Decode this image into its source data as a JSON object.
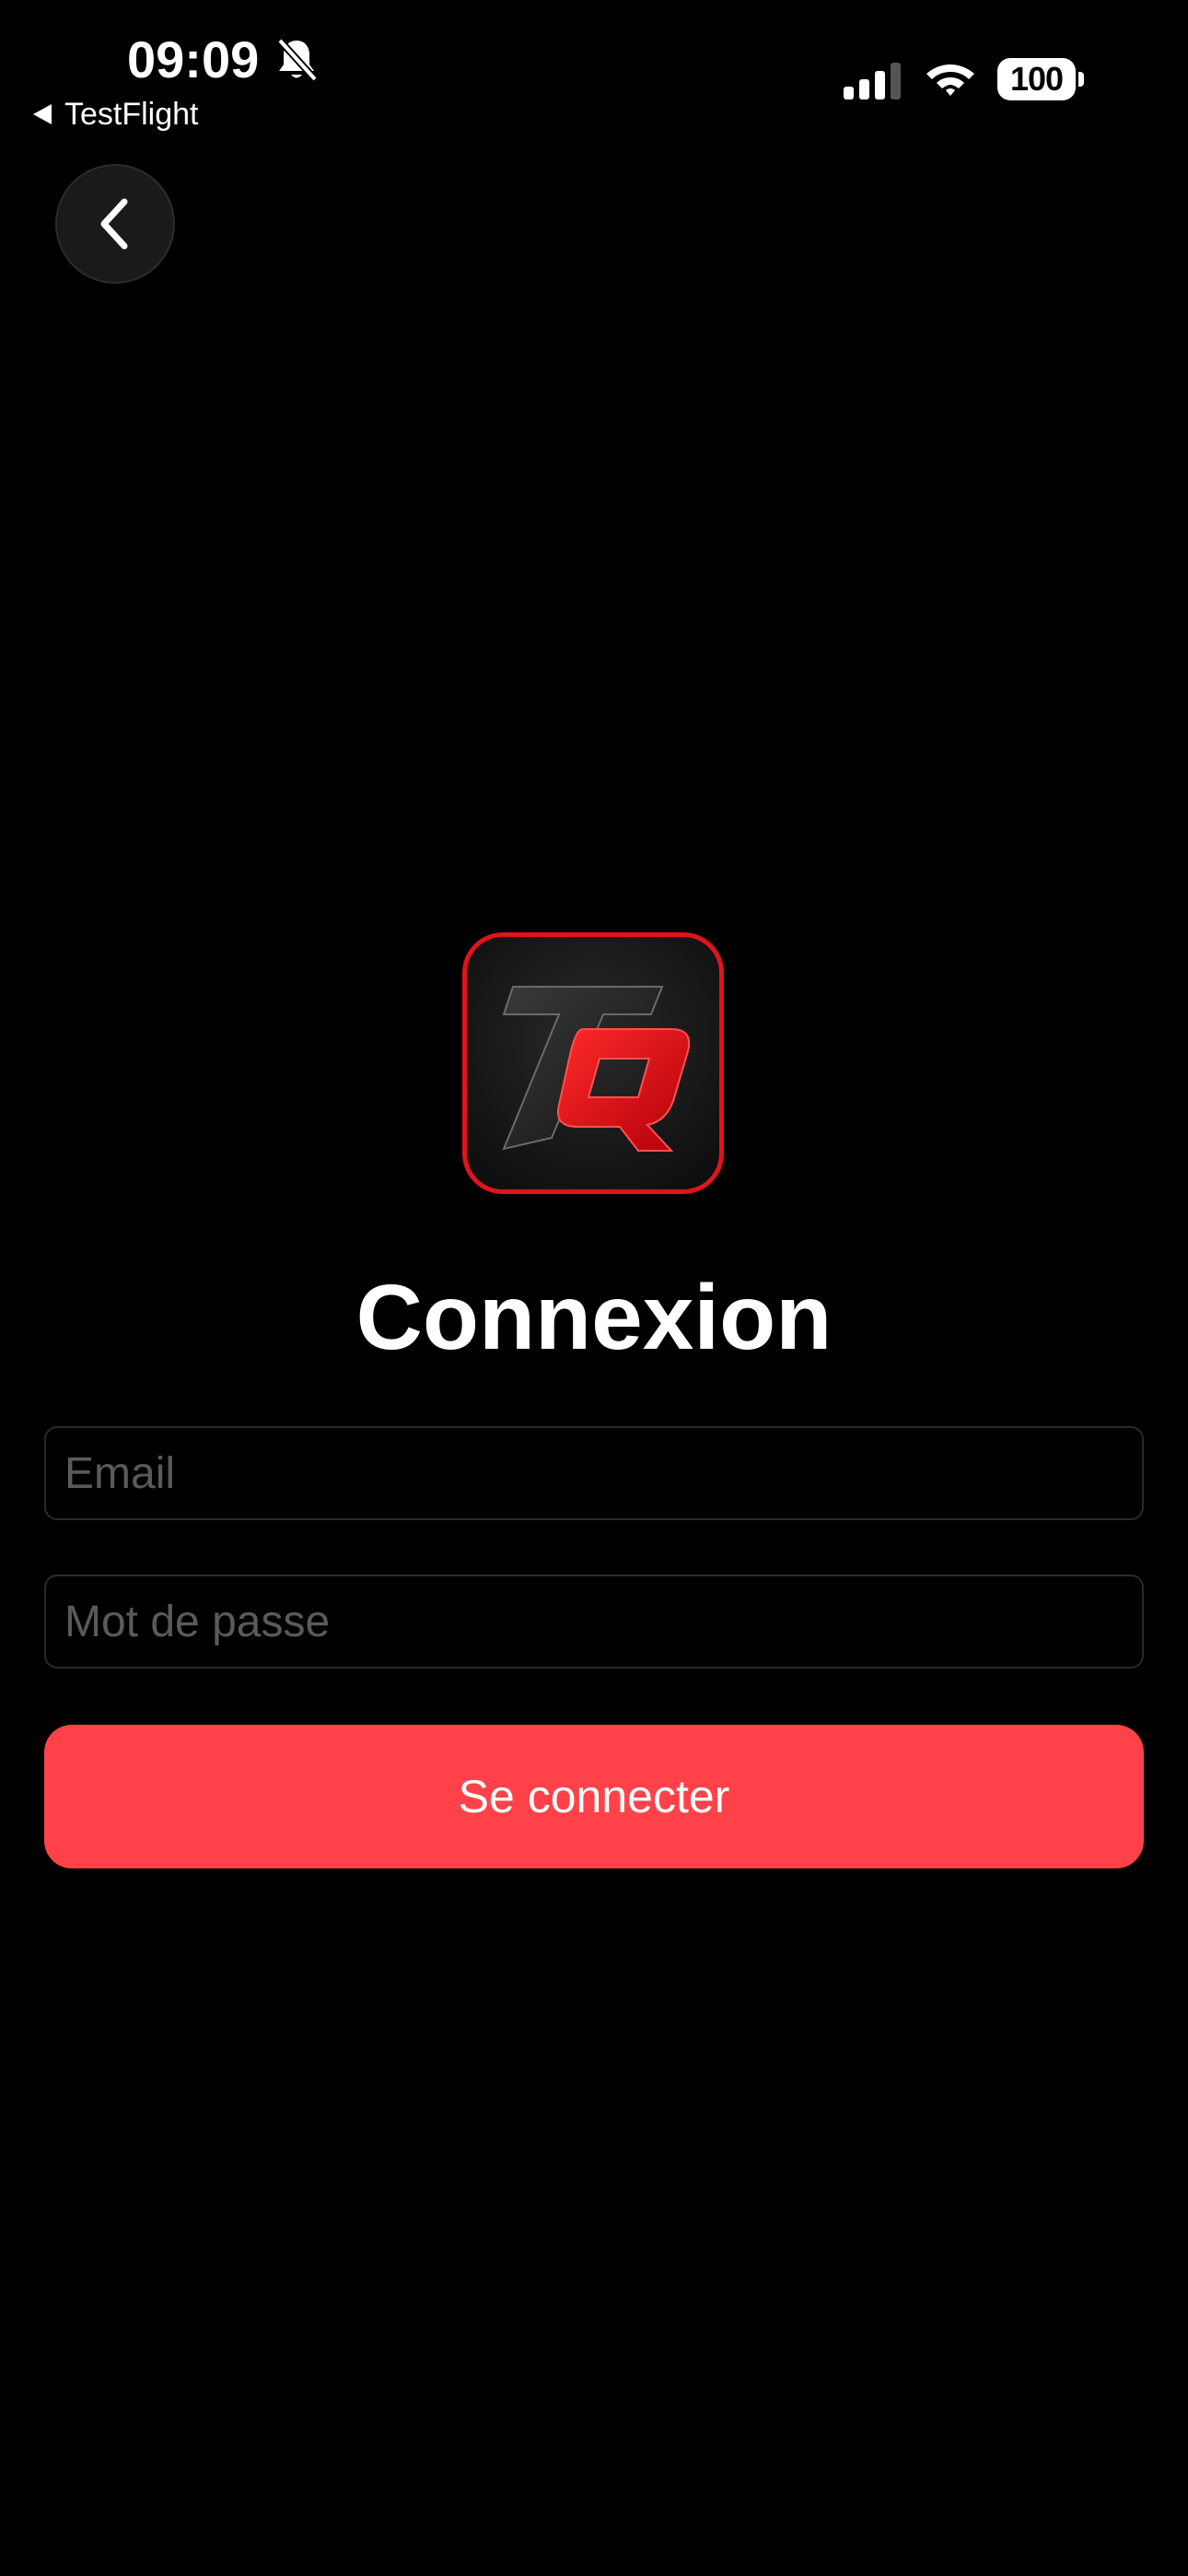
{
  "status_bar": {
    "time": "09:09",
    "back_app_label": "TestFlight",
    "battery_level": "100",
    "icons": [
      "bell-slash-icon",
      "signal-icon",
      "wifi-icon",
      "battery-icon"
    ]
  },
  "nav": {
    "back_icon": "chevron-left-icon"
  },
  "logo": {
    "text": "TQ",
    "accent_color": "#e0141b"
  },
  "page": {
    "title": "Connexion"
  },
  "form": {
    "email_placeholder": "Email",
    "email_value": "",
    "password_placeholder": "Mot de passe",
    "password_value": "",
    "submit_label": "Se connecter"
  },
  "colors": {
    "background": "#000000",
    "button": "#ff4249",
    "field_border": "#2a2a2a",
    "placeholder": "#5a5a5a"
  }
}
